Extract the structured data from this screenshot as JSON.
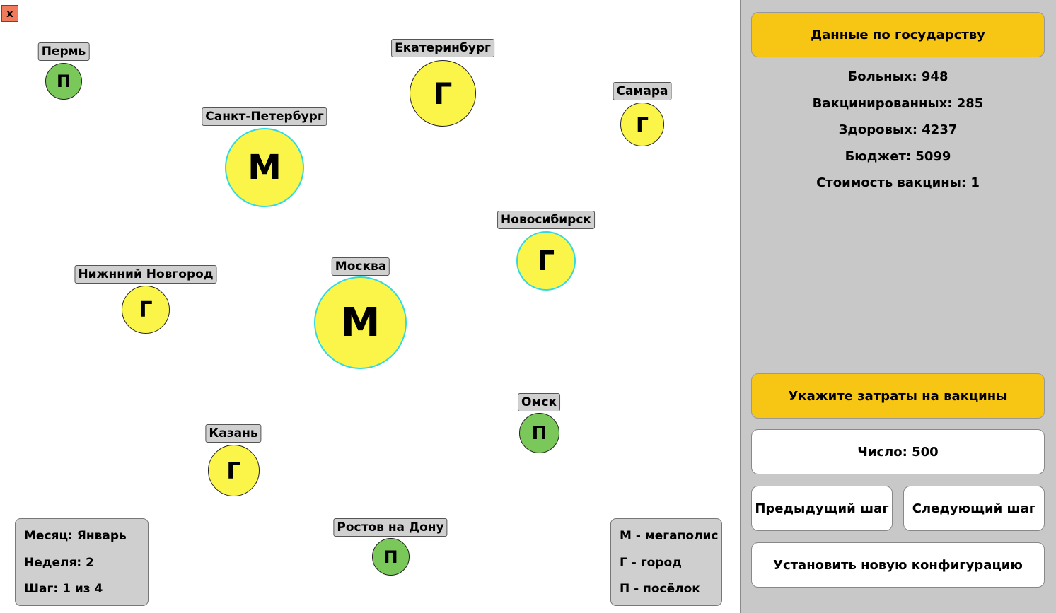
{
  "close_button": {
    "label": "x"
  },
  "cities": {
    "perm": {
      "name": "Пермь",
      "type": "П"
    },
    "ekb": {
      "name": "Екатеринбург",
      "type": "Г"
    },
    "samara": {
      "name": "Самара",
      "type": "Г"
    },
    "spb": {
      "name": "Санкт-Петербург",
      "type": "М"
    },
    "novosib": {
      "name": "Новосибирск",
      "type": "Г"
    },
    "nnovgorod": {
      "name": "Нижнний Новгород",
      "type": "Г"
    },
    "moscow": {
      "name": "Москва",
      "type": "М"
    },
    "omsk": {
      "name": "Омск",
      "type": "П"
    },
    "kazan": {
      "name": "Казань",
      "type": "Г"
    },
    "rostov": {
      "name": "Ростов на Дону",
      "type": "П"
    }
  },
  "time_panel": {
    "month": "Месяц: Январь",
    "week": "Неделя: 2",
    "step": "Шаг: 1 из 4"
  },
  "legend": {
    "megapolis": "М - мегаполис",
    "city": "Г - город",
    "village": "П - посёлок"
  },
  "sidebar": {
    "state_header": "Данные по государству",
    "stats": {
      "sick": "Больных: 948",
      "vaccinated": "Вакцинированных: 285",
      "healthy": "Здоровых: 4237",
      "budget": "Бюджет: 5099",
      "vaccine_cost": "Стоимость вакцины: 1"
    },
    "vaccine_header": "Укажите затраты на вакцины",
    "number_field": "Число:  500",
    "prev_step": "Предыдущий шаг",
    "next_step": "Следующий шаг",
    "new_config": "Установить новую конфигурацию"
  },
  "colors": {
    "orange": "#f7c514",
    "yellow_city": "#fbf54a",
    "green_village": "#7ac85a",
    "highlight": "#33d9df",
    "close": "#f07a5c"
  }
}
